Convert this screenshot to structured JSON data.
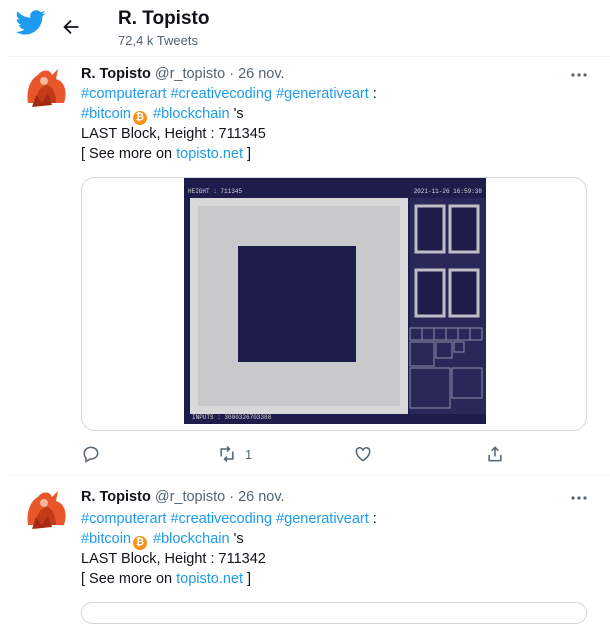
{
  "header": {
    "title": "R. Topisto",
    "subtitle": "72,4 k Tweets"
  },
  "colors": {
    "twitter_blue": "#1d9bf0",
    "text": "#0f1419",
    "muted": "#536471",
    "bitcoin": "#f7931a",
    "art_dark": "#1e1c4a",
    "art_light": "#d8d8d8"
  },
  "tweets": [
    {
      "name": "R. Topisto",
      "handle": "@r_topisto",
      "date": "· 26 nov.",
      "hashtags_line1": [
        "#computerart",
        "#creativecoding",
        "#generativeart"
      ],
      "line1_suffix": " :",
      "tag_bitcoin": "#bitcoin",
      "bitcoin_glyph": "₿",
      "tag_blockchain": "#blockchain",
      "line2_suffix": " 's",
      "line3": "LAST Block, Height : 711345",
      "more_prefix": "[ See more on ",
      "link": "topisto.net",
      "more_suffix": " ]",
      "image": {
        "top_left_text": "HEIGHT : 711345",
        "top_right_text": "2021-11-26 16:59:38",
        "bottom_left_text": "INPUTS : 3000326703388"
      },
      "actions": {
        "reply": "",
        "retweet": "1",
        "like": "",
        "share": ""
      }
    },
    {
      "name": "R. Topisto",
      "handle": "@r_topisto",
      "date": "· 26 nov.",
      "hashtags_line1": [
        "#computerart",
        "#creativecoding",
        "#generativeart"
      ],
      "line1_suffix": " :",
      "tag_bitcoin": "#bitcoin",
      "bitcoin_glyph": "₿",
      "tag_blockchain": "#blockchain",
      "line2_suffix": " 's",
      "line3": "LAST Block, Height : 711342",
      "more_prefix": "[ See more on ",
      "link": "topisto.net",
      "more_suffix": " ]"
    }
  ]
}
